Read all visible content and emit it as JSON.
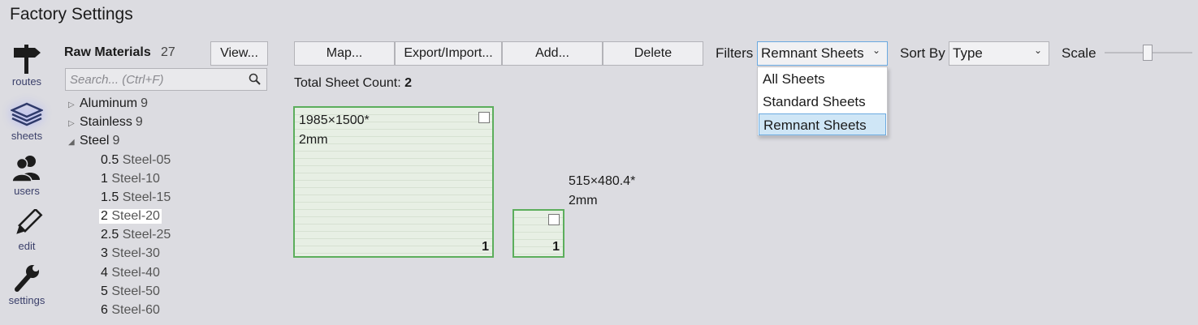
{
  "window": {
    "title": "Factory Settings"
  },
  "nav": {
    "items": [
      {
        "label": "routes",
        "icon": "signpost-icon"
      },
      {
        "label": "sheets",
        "icon": "stacked-sheets-icon",
        "selected": true
      },
      {
        "label": "users",
        "icon": "users-icon"
      },
      {
        "label": "edit",
        "icon": "pencil-icon"
      },
      {
        "label": "settings",
        "icon": "wrench-icon"
      }
    ]
  },
  "materials": {
    "title": "Raw Materials",
    "count": "27",
    "view_label": "View...",
    "search_placeholder": "Search... (Ctrl+F)",
    "groups": [
      {
        "name": "Aluminum",
        "count": "9",
        "expanded": false
      },
      {
        "name": "Stainless",
        "count": "9",
        "expanded": false
      },
      {
        "name": "Steel",
        "count": "9",
        "expanded": true
      }
    ],
    "steel_items": [
      {
        "thickness": "0.5",
        "grade": "Steel-05"
      },
      {
        "thickness": "1",
        "grade": "Steel-10"
      },
      {
        "thickness": "1.5",
        "grade": "Steel-15"
      },
      {
        "thickness": "2",
        "grade": "Steel-20",
        "selected": true
      },
      {
        "thickness": "2.5",
        "grade": "Steel-25"
      },
      {
        "thickness": "3",
        "grade": "Steel-30"
      },
      {
        "thickness": "4",
        "grade": "Steel-40"
      },
      {
        "thickness": "5",
        "grade": "Steel-50"
      },
      {
        "thickness": "6",
        "grade": "Steel-60"
      }
    ]
  },
  "toolbar": {
    "map_label": "Map...",
    "export_label": "Export/Import...",
    "add_label": "Add...",
    "delete_label": "Delete",
    "filters_label": "Filters",
    "filters_value": "Remnant Sheets",
    "sortby_label": "Sort By",
    "sortby_value": "Type",
    "scale_label": "Scale",
    "scale_level": 0.5
  },
  "filter_options": [
    "All Sheets",
    "Standard Sheets",
    "Remnant Sheets"
  ],
  "summary": {
    "label": "Total Sheet Count:",
    "value": "2"
  },
  "sheets": [
    {
      "size": "1985×1500*",
      "thickness": "2mm",
      "quantity": "1"
    },
    {
      "size": "515×480.4*",
      "thickness": "2mm",
      "quantity": "1"
    }
  ],
  "colors": {
    "sheet_border": "#5cae5c",
    "sheet_fill": "#e7efe4",
    "selection": "#cfe6f6"
  }
}
